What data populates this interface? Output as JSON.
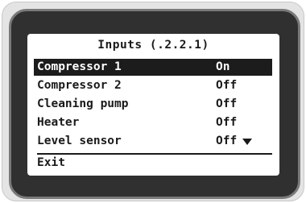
{
  "screen": {
    "title": "Inputs (.2.2.1)",
    "rows": [
      {
        "label": "Compressor 1",
        "value": "On",
        "selected": true
      },
      {
        "label": "Compressor 2",
        "value": "Off",
        "selected": false
      },
      {
        "label": "Cleaning pump",
        "value": "Off",
        "selected": false
      },
      {
        "label": "Heater",
        "value": "Off",
        "selected": false
      },
      {
        "label": "Level sensor",
        "value": "Off",
        "selected": false
      }
    ],
    "scroll_icon": "triangle-down-icon",
    "exit_label": "Exit"
  }
}
